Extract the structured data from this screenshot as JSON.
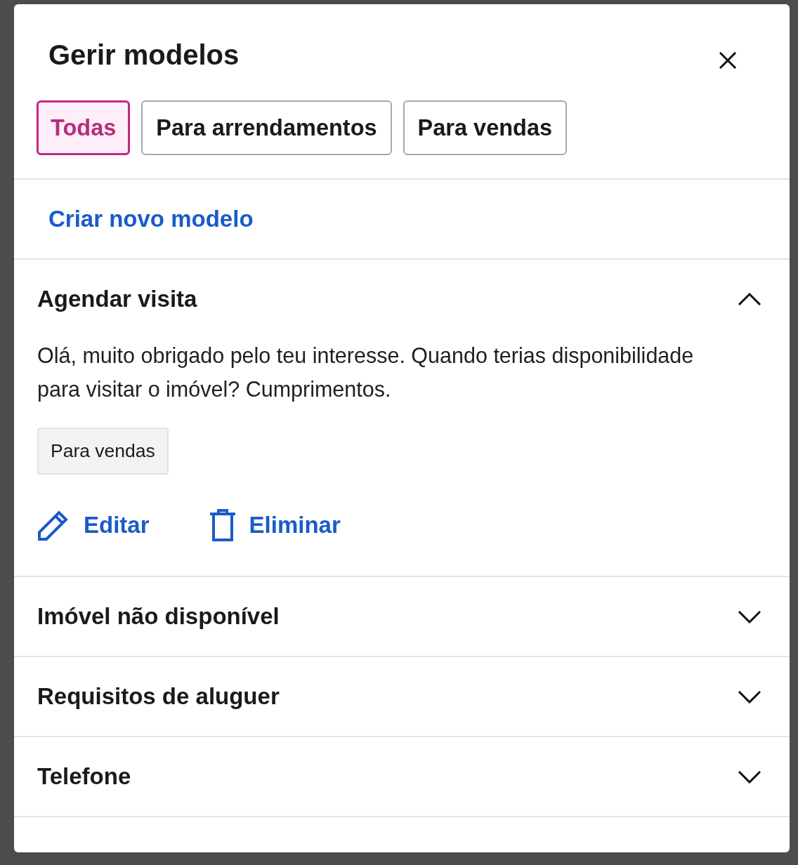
{
  "dialog": {
    "title": "Gerir modelos"
  },
  "filters": [
    {
      "label": "Todas",
      "selected": true
    },
    {
      "label": "Para arrendamentos",
      "selected": false
    },
    {
      "label": "Para vendas",
      "selected": false
    }
  ],
  "create_link": "Criar novo modelo",
  "templates": [
    {
      "title": "Agendar visita",
      "expanded": true,
      "message": "Olá, muito obrigado pelo teu interesse. Quando terias disponibilidade para visitar o imóvel? Cumprimentos.",
      "tag": "Para vendas",
      "actions": [
        {
          "kind": "edit",
          "label": "Editar"
        },
        {
          "kind": "delete",
          "label": "Eliminar"
        }
      ]
    },
    {
      "title": "Imóvel não disponível",
      "expanded": false
    },
    {
      "title": "Requisitos de aluguer",
      "expanded": false
    },
    {
      "title": "Telefone",
      "expanded": false
    }
  ]
}
